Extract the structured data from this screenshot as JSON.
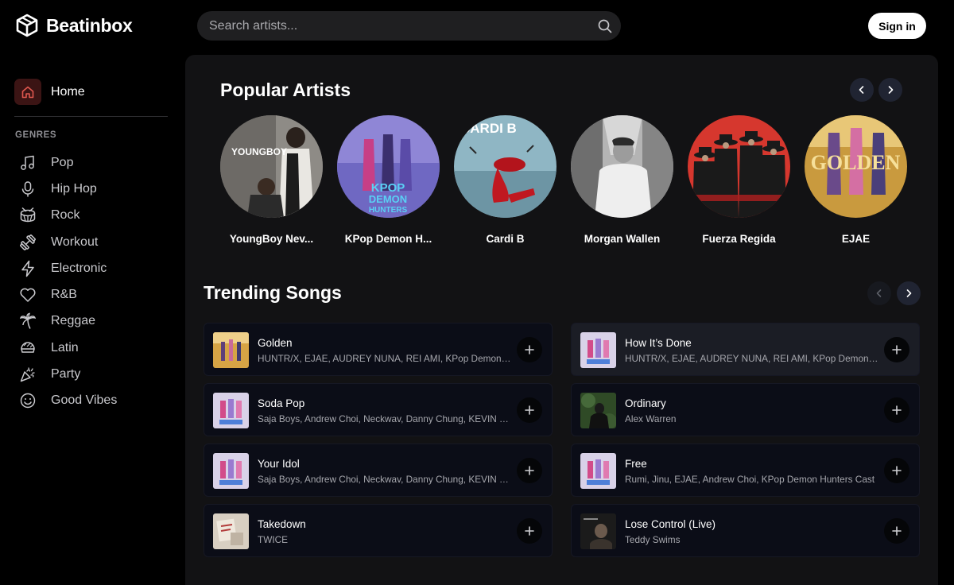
{
  "app": {
    "name": "Beatinbox"
  },
  "search": {
    "placeholder": "Search artists..."
  },
  "auth": {
    "signin_label": "Sign in"
  },
  "sidebar": {
    "home_label": "Home",
    "genres_title": "GENRES",
    "genres": [
      {
        "label": "Pop",
        "icon": "music-note-icon"
      },
      {
        "label": "Hip Hop",
        "icon": "microphone-icon"
      },
      {
        "label": "Rock",
        "icon": "drum-icon"
      },
      {
        "label": "Workout",
        "icon": "dumbbell-icon"
      },
      {
        "label": "Electronic",
        "icon": "lightning-icon"
      },
      {
        "label": "R&B",
        "icon": "heart-icon"
      },
      {
        "label": "Reggae",
        "icon": "palm-tree-icon"
      },
      {
        "label": "Latin",
        "icon": "maracas-icon"
      },
      {
        "label": "Party",
        "icon": "party-popper-icon"
      },
      {
        "label": "Good Vibes",
        "icon": "smiley-icon"
      }
    ]
  },
  "popular_artists": {
    "title": "Popular Artists",
    "artists": [
      {
        "name": "YoungBoy Nev..."
      },
      {
        "name": "KPop Demon H..."
      },
      {
        "name": "Cardi B"
      },
      {
        "name": "Morgan Wallen"
      },
      {
        "name": "Fuerza Regida"
      },
      {
        "name": "EJAE"
      }
    ],
    "image_text": {
      "youngboy": "YOUNGBOY",
      "kpop_line1": "KPOP",
      "kpop_line2": "DEMON",
      "kpop_line3": "HUNTERS",
      "cardi": "CARDI B",
      "ejae": "GOLDEN"
    }
  },
  "trending_songs": {
    "title": "Trending Songs",
    "songs": [
      {
        "title": "Golden",
        "artists": "HUNTR/X, EJAE, AUDREY NUNA, REI AMI, KPop Demon Hunters Cast"
      },
      {
        "title": "How It’s Done",
        "artists": "HUNTR/X, EJAE, AUDREY NUNA, REI AMI, KPop Demon Hunters Cast"
      },
      {
        "title": "Soda Pop",
        "artists": "Saja Boys, Andrew Choi, Neckwav, Danny Chung, KEVIN WOO, samUIL Lee, KPop Demon Hunters Cast"
      },
      {
        "title": "Ordinary",
        "artists": "Alex Warren"
      },
      {
        "title": "Your Idol",
        "artists": "Saja Boys, Andrew Choi, Neckwav, Danny Chung, KEVIN WOO, samUIL Lee, KPop Demon Hunters Cast"
      },
      {
        "title": "Free",
        "artists": "Rumi, Jinu, EJAE, Andrew Choi, KPop Demon Hunters Cast"
      },
      {
        "title": "Takedown",
        "artists": "TWICE"
      },
      {
        "title": "Lose Control (Live)",
        "artists": "Teddy Swims"
      }
    ]
  },
  "colors": {
    "background": "#000000",
    "panel": "#121214",
    "card": "#0b0d17",
    "card_highlight": "#1b1d25",
    "accent_home": "#e0584f",
    "muted_text": "#a6a7ad"
  }
}
